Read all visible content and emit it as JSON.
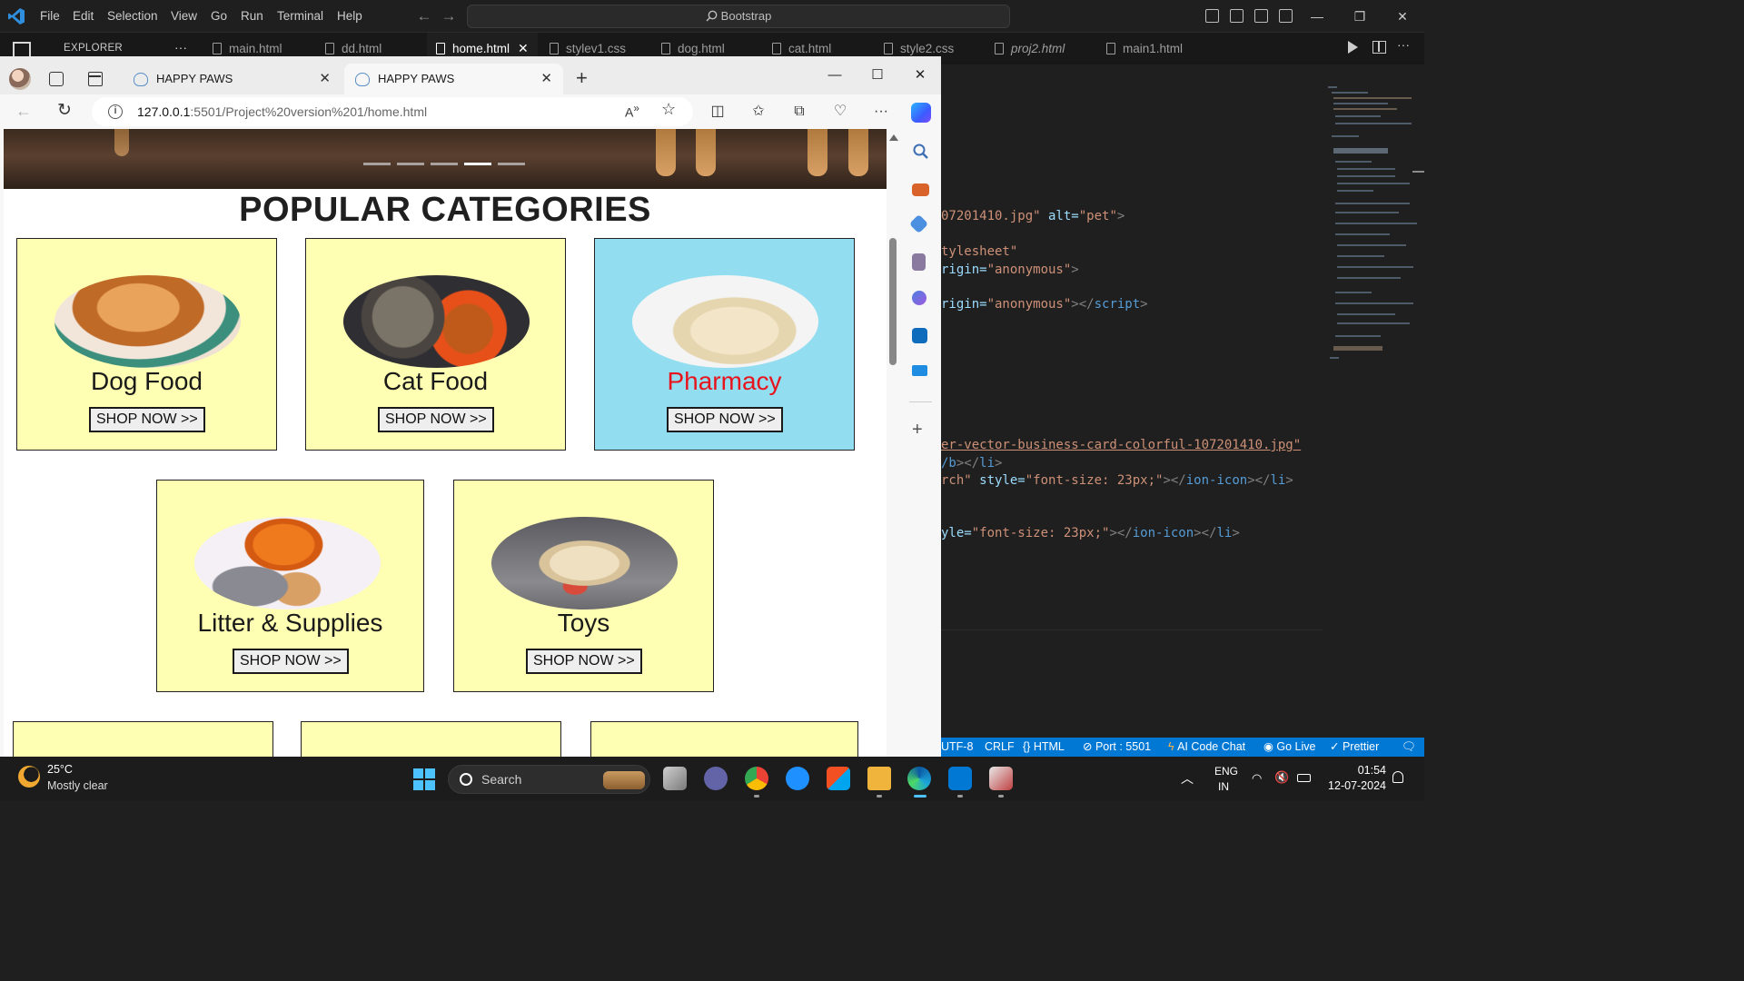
{
  "vscode": {
    "menu": [
      "File",
      "Edit",
      "Selection",
      "View",
      "Go",
      "Run",
      "Terminal",
      "Help"
    ],
    "search": "Bootstrap",
    "explorer_title": "EXPLORER",
    "explorer_more": "···",
    "tabs": [
      {
        "label": "main.html"
      },
      {
        "label": "dd.html"
      },
      {
        "label": "home.html",
        "active": true
      },
      {
        "label": "stylev1.css"
      },
      {
        "label": "dog.html"
      },
      {
        "label": "cat.html"
      },
      {
        "label": "style2.css"
      },
      {
        "label": "proj2.html"
      },
      {
        "label": "main1.html"
      }
    ],
    "code": {
      "l1a": "07201410.jpg\"",
      "l1b": " alt=",
      "l1c": "\"pet\"",
      "l1d": ">",
      "l2": "tylesheet\"",
      "l3a": "rigin=",
      "l3b": "\"anonymous\"",
      "l3c": ">",
      "l4a": "rigin=",
      "l4b": "\"anonymous\"",
      "l4c": "></",
      "l4d": "script",
      "l4e": ">",
      "l5": "er-vector-business-card-colorful-107201410.jpg\"",
      "l6a": "/b",
      "l6b": "></",
      "l6c": "li",
      "l6d": ">",
      "l7a": "rch\"",
      "l7b": " style=",
      "l7c": "\"font-size: 23px;\"",
      "l7d": "></",
      "l7e": "ion-icon",
      "l7f": "></",
      "l7g": "li",
      "l7h": ">",
      "l8a": "yle=",
      "l8b": "\"font-size: 23px;\"",
      "l8c": "></",
      "l8d": "ion-icon",
      "l8e": "></",
      "l8f": "li",
      "l8g": ">"
    },
    "status": {
      "encoding": "UTF-8",
      "eol": "CRLF",
      "language": "HTML",
      "port": "Port : 5501",
      "ai": "AI Code Chat",
      "live": "Go Live",
      "prettier": "Prettier"
    }
  },
  "browser": {
    "tabs": [
      {
        "title": "HAPPY PAWS"
      },
      {
        "title": "HAPPY PAWS",
        "active": true
      }
    ],
    "url_host": "127.0.0.1",
    "url_path": ":5501/Project%20version%201/home.html"
  },
  "page": {
    "heading": "POPULAR CATEGORIES",
    "carousel": {
      "count": 5,
      "active_index": 3
    },
    "categories": [
      {
        "title": "Dog Food",
        "button": "SHOP NOW >>",
        "image": "dog-eating-photo",
        "bg": "#ffffb3",
        "title_color": "#1a1a1a"
      },
      {
        "title": "Cat Food",
        "button": "SHOP NOW >>",
        "image": "cat-food-photo",
        "bg": "#ffffb3",
        "title_color": "#1a1a1a"
      },
      {
        "title": "Pharmacy",
        "button": "SHOP NOW >>",
        "image": "vet-dog-photo",
        "bg": "#93ddf0",
        "title_color": "#e8141d"
      },
      {
        "title": "Litter & Supplies",
        "button": "SHOP NOW >>",
        "image": "cat-litter-photo",
        "bg": "#ffffb3",
        "title_color": "#1a1a1a"
      },
      {
        "title": "Toys",
        "button": "SHOP NOW >>",
        "image": "puppy-toy-photo",
        "bg": "#ffffb3",
        "title_color": "#1a1a1a"
      }
    ]
  },
  "taskbar": {
    "weather_temp": "25°C",
    "weather_desc": "Mostly clear",
    "search": "Search",
    "lang_1": "ENG",
    "lang_2": "IN",
    "time": "01:54",
    "date": "12-07-2024"
  },
  "colors": {
    "vscode_bg": "#1f1f1f",
    "status_bar": "#0078d4",
    "card_yellow": "#ffffb3",
    "card_blue": "#93ddf0",
    "pharmacy_red": "#e8141d"
  }
}
